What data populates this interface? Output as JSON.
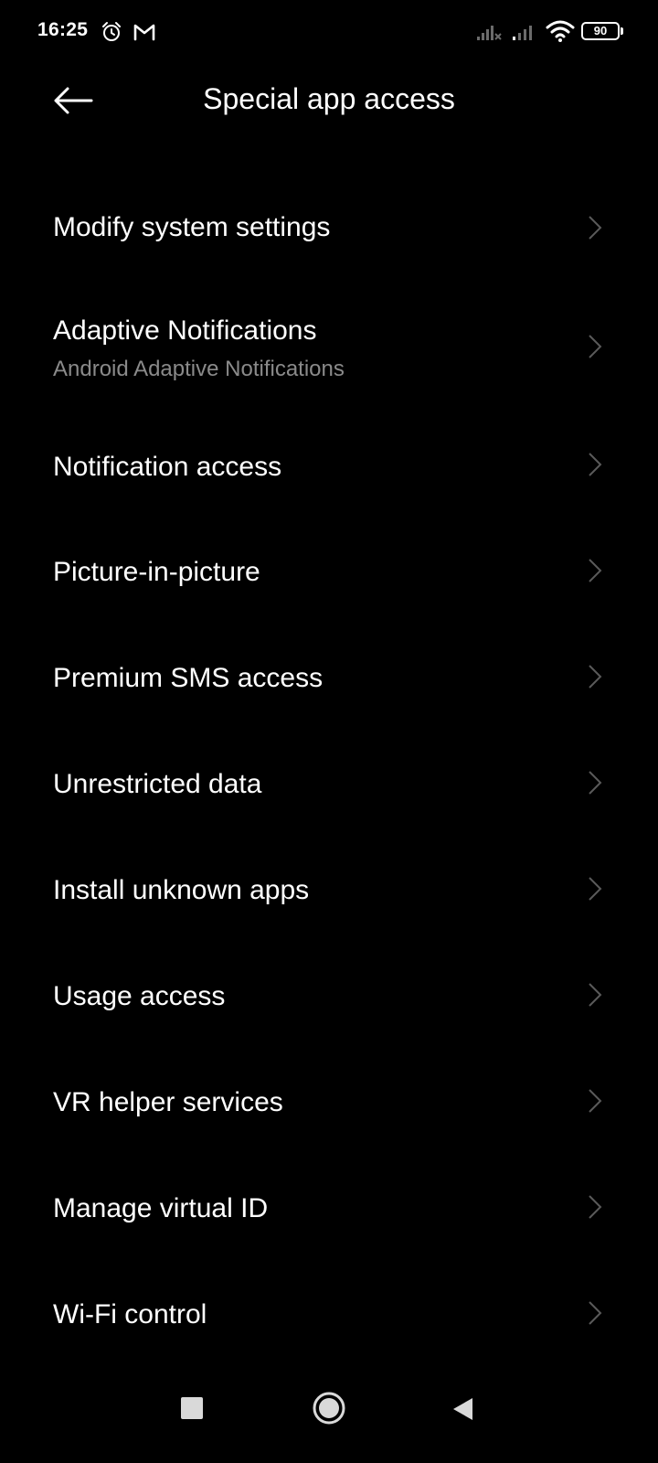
{
  "status_bar": {
    "time": "16:25",
    "battery_level": "90",
    "icons": [
      "alarm-icon",
      "gmail-icon",
      "signal-1-icon",
      "signal-2-icon",
      "wifi-icon",
      "battery-icon"
    ]
  },
  "header": {
    "title": "Special app access",
    "back_icon": "arrow-left-icon"
  },
  "items": [
    {
      "label": "Modify system settings"
    },
    {
      "label": "Adaptive Notifications",
      "sublabel": "Android Adaptive Notifications"
    },
    {
      "label": "Notification access"
    },
    {
      "label": "Picture-in-picture"
    },
    {
      "label": "Premium SMS access"
    },
    {
      "label": "Unrestricted data"
    },
    {
      "label": "Install unknown apps"
    },
    {
      "label": "Usage access"
    },
    {
      "label": "VR helper services"
    },
    {
      "label": "Manage virtual ID"
    },
    {
      "label": "Wi-Fi control"
    }
  ],
  "nav_bar": {
    "icons": [
      "recents-square-icon",
      "home-circle-icon",
      "back-triangle-icon"
    ]
  },
  "colors": {
    "background": "#000000",
    "text_primary": "#ffffff",
    "text_secondary": "#8a8a8a",
    "chevron": "#5a5a5a"
  }
}
